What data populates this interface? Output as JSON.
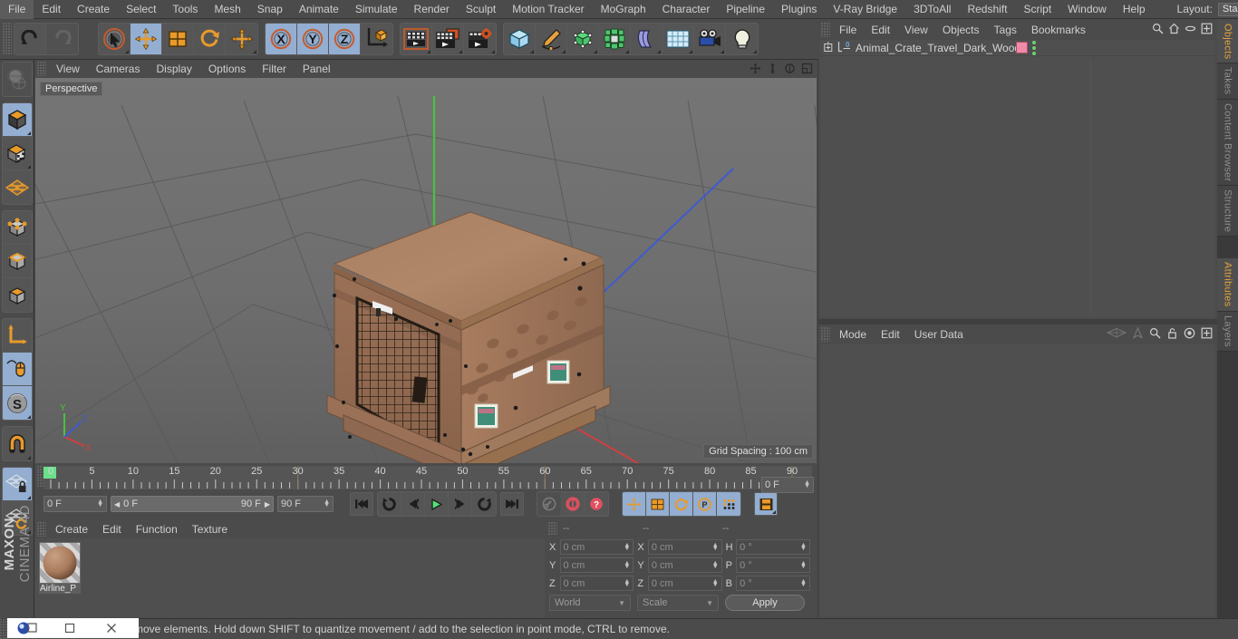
{
  "menubar": {
    "items": [
      "File",
      "Edit",
      "Create",
      "Select",
      "Tools",
      "Mesh",
      "Snap",
      "Animate",
      "Simulate",
      "Render",
      "Sculpt",
      "Motion Tracker",
      "MoGraph",
      "Character",
      "Pipeline",
      "Plugins",
      "V-Ray Bridge",
      "3DToAll",
      "Redshift",
      "Script",
      "Window",
      "Help"
    ],
    "layout_label": "Layout:",
    "layout_value": "Startup",
    "search_icon": "search-icon"
  },
  "toolbar": {
    "groups": [
      {
        "name": "undo-redo",
        "buttons": [
          {
            "icon": "undo-icon",
            "label": "Undo",
            "state": "normal"
          },
          {
            "icon": "redo-icon",
            "label": "Redo",
            "state": "disabled"
          }
        ]
      },
      {
        "name": "transform-tools",
        "buttons": [
          {
            "icon": "select-live-icon",
            "label": "Live Selection",
            "state": "normal"
          },
          {
            "icon": "move-icon",
            "label": "Move",
            "state": "active"
          },
          {
            "icon": "scale-icon",
            "label": "Scale",
            "state": "normal"
          },
          {
            "icon": "rotate-icon",
            "label": "Rotate",
            "state": "normal"
          },
          {
            "icon": "move-alt-icon",
            "label": "Move",
            "state": "normal"
          }
        ]
      },
      {
        "name": "axis-locks",
        "buttons": [
          {
            "icon": "x-axis-icon",
            "label": "X",
            "state": "active"
          },
          {
            "icon": "y-axis-icon",
            "label": "Y",
            "state": "active"
          },
          {
            "icon": "z-axis-icon",
            "label": "Z",
            "state": "active"
          },
          {
            "icon": "world-coord-icon",
            "label": "World/Object",
            "state": "normal"
          }
        ]
      },
      {
        "name": "render-tools",
        "buttons": [
          {
            "icon": "render-view-icon",
            "label": "Render View",
            "state": "normal"
          },
          {
            "icon": "render-picture-viewer-icon",
            "label": "Render to Picture Viewer",
            "state": "normal"
          },
          {
            "icon": "render-settings-icon",
            "label": "Edit Render Settings",
            "state": "normal"
          }
        ]
      },
      {
        "name": "create-objects",
        "buttons": [
          {
            "icon": "cube-primitive-icon",
            "label": "Cube",
            "state": "normal"
          },
          {
            "icon": "spline-pen-icon",
            "label": "Spline",
            "state": "normal"
          },
          {
            "icon": "generator-icon",
            "label": "Subdivision Surface",
            "state": "normal"
          },
          {
            "icon": "mograph-cloner-icon",
            "label": "Cloner",
            "state": "normal"
          },
          {
            "icon": "deformer-bend-icon",
            "label": "Bend",
            "state": "normal"
          },
          {
            "icon": "environment-floor-icon",
            "label": "Floor",
            "state": "normal"
          },
          {
            "icon": "camera-icon",
            "label": "Camera",
            "state": "normal"
          },
          {
            "icon": "light-icon",
            "label": "Light",
            "state": "normal"
          }
        ]
      }
    ]
  },
  "left_toolbar": {
    "groups": [
      [
        {
          "icon": "texture-axis-icon",
          "label": "Texture Axis",
          "state": "dim"
        }
      ],
      [
        {
          "icon": "model-mode-icon",
          "label": "Model Mode",
          "state": "active"
        },
        {
          "icon": "texture-mode-icon",
          "label": "Texture Mode",
          "state": "normal"
        },
        {
          "icon": "polygon-grid-icon",
          "label": "Workplane",
          "state": "normal"
        }
      ],
      [
        {
          "icon": "point-mode-icon",
          "label": "Points",
          "state": "normal"
        },
        {
          "icon": "edge-mode-icon",
          "label": "Edges",
          "state": "normal"
        },
        {
          "icon": "polygon-mode-icon",
          "label": "Polygons",
          "state": "normal"
        }
      ],
      [
        {
          "icon": "axis-move-icon",
          "label": "Enable Axis",
          "state": "normal"
        },
        {
          "icon": "viewport-solo-icon",
          "label": "Viewport Solo",
          "state": "active"
        },
        {
          "icon": "snap-s-icon",
          "label": "Enable Snapping",
          "state": "active"
        }
      ],
      [
        {
          "icon": "magnet-icon",
          "label": "Magnet",
          "state": "normal"
        }
      ],
      [
        {
          "icon": "workplane-lock-icon",
          "label": "Lock Workplane",
          "state": "active"
        },
        {
          "icon": "workplane-reset-icon",
          "label": "Reset Workplane",
          "state": "normal"
        }
      ]
    ],
    "brand_line1": "MAXON",
    "brand_line2": "CINEMA 4D"
  },
  "viewport": {
    "menu": [
      "View",
      "Cameras",
      "Display",
      "Options",
      "Filter",
      "Panel"
    ],
    "nav_icons": [
      "pan-icon",
      "dolly-icon",
      "orbit-icon",
      "maximize-viewport-icon"
    ],
    "label": "Perspective",
    "grid_spacing": "Grid Spacing : 100 cm",
    "axis_gizmo": {
      "x": "X",
      "y": "Y",
      "z": "Z",
      "x_color": "#e03a3a",
      "y_color": "#3ac93a",
      "z_color": "#3a57e0"
    },
    "scene_object": "Animal_Crate_Travel_Dark_Wood"
  },
  "timeline": {
    "ticks": [
      "0",
      "5",
      "10",
      "15",
      "20",
      "25",
      "30",
      "35",
      "40",
      "45",
      "50",
      "55",
      "60",
      "65",
      "70",
      "75",
      "80",
      "85",
      "90"
    ],
    "start_frame": "0 F",
    "current_frame": "0 F",
    "range_start": "0 F",
    "range_end": "90 F",
    "end_frame": "90 F",
    "right_frame_field": "0 F",
    "playback_buttons": [
      {
        "icon": "go-to-start-icon",
        "label": "Go to Start"
      },
      {
        "icon": "previous-key-icon",
        "label": "Go to Previous Key"
      },
      {
        "icon": "step-back-icon",
        "label": "Go Back One Frame"
      },
      {
        "icon": "play-forward-icon",
        "label": "Play Forwards"
      },
      {
        "icon": "step-forward-icon",
        "label": "Go Forward One Frame"
      },
      {
        "icon": "next-key-icon",
        "label": "Go to Next Key"
      },
      {
        "icon": "go-to-end-icon",
        "label": "Go to End"
      }
    ],
    "record_buttons": [
      {
        "icon": "record-key-icon",
        "label": "Record Active Objects",
        "state": "dim"
      },
      {
        "icon": "autokey-icon",
        "label": "Autokeying",
        "state": "normal"
      },
      {
        "icon": "keyframe-selection-icon",
        "label": "Keyframe Selection",
        "state": "normal"
      }
    ],
    "key_toggles": [
      {
        "icon": "position-key-icon",
        "label": "Position",
        "state": "active"
      },
      {
        "icon": "scale-key-icon",
        "label": "Scale",
        "state": "active"
      },
      {
        "icon": "rotation-key-icon",
        "label": "Rotation",
        "state": "active"
      },
      {
        "icon": "pla-key-icon",
        "label": "Point Level Animation",
        "state": "active"
      },
      {
        "icon": "parameter-key-icon",
        "label": "Parameter",
        "state": "active"
      }
    ],
    "dope_sheet": {
      "icon": "timeline-icon",
      "label": "Timeline",
      "state": "active"
    }
  },
  "material_manager": {
    "menu": [
      "Create",
      "Edit",
      "Function",
      "Texture"
    ],
    "materials": [
      {
        "name": "Airline_P",
        "color": "#a97a5c"
      }
    ]
  },
  "coordinates": {
    "header": [
      "--",
      "--",
      "--"
    ],
    "rows": [
      {
        "l1": "X",
        "v1": "0 cm",
        "l2": "X",
        "v2": "0 cm",
        "l3": "H",
        "v3": "0 °"
      },
      {
        "l1": "Y",
        "v1": "0 cm",
        "l2": "Y",
        "v2": "0 cm",
        "l3": "P",
        "v3": "0 °"
      },
      {
        "l1": "Z",
        "v1": "0 cm",
        "l2": "Z",
        "v2": "0 cm",
        "l3": "B",
        "v3": "0 °"
      }
    ],
    "system": "World",
    "mode": "Scale",
    "apply_label": "Apply"
  },
  "object_manager": {
    "menu": [
      "File",
      "Edit",
      "View",
      "Objects",
      "Tags",
      "Bookmarks"
    ],
    "icons": [
      "search-icon",
      "home-icon",
      "ellipse-icon",
      "expand-icon"
    ],
    "rows": [
      {
        "name": "Animal_Crate_Travel_Dark_Wood",
        "tag_color": "#f08aa8",
        "dots_color": "#6fd06f"
      }
    ]
  },
  "attribute_manager": {
    "menu": [
      "Mode",
      "Edit",
      "User Data"
    ],
    "icons": [
      "lasso-icon",
      "pin-icon",
      "search-icon",
      "lock-icon",
      "target-icon",
      "expand-icon"
    ]
  },
  "right_tabs_top": [
    "Objects",
    "Takes",
    "Content Browser",
    "Structure"
  ],
  "right_tabs_bottom": [
    "Attributes",
    "Layers"
  ],
  "statusbar": {
    "text": "move elements. Hold down SHIFT to quantize movement / add to the selection in point mode, CTRL to remove.",
    "window_controls": [
      "app-icon",
      "minimize-button",
      "maximize-button",
      "close-button"
    ]
  }
}
